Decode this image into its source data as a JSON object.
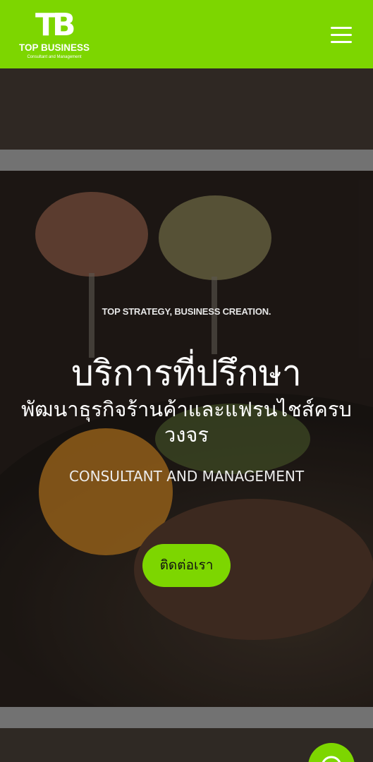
{
  "header": {
    "logo_mark": "TB",
    "brand_name": "TOP BUSINESS",
    "brand_tagline": "Consultant and Management"
  },
  "hero": {
    "tagline": "TOP STRATEGY, BUSINESS CREATION.",
    "headline": "บริการที่ปรึกษา",
    "subheadline": "พัฒนาธุรกิจร้านค้าและแฟรนไชส์ครบวงจร",
    "service_label": "CONSULTANT AND MANAGEMENT",
    "contact_button_label": "ติดต่อเรา"
  },
  "colors": {
    "brand_green": "#7dd600"
  },
  "icons": {
    "menu": "hamburger-menu-icon",
    "chat": "chat-icon"
  }
}
